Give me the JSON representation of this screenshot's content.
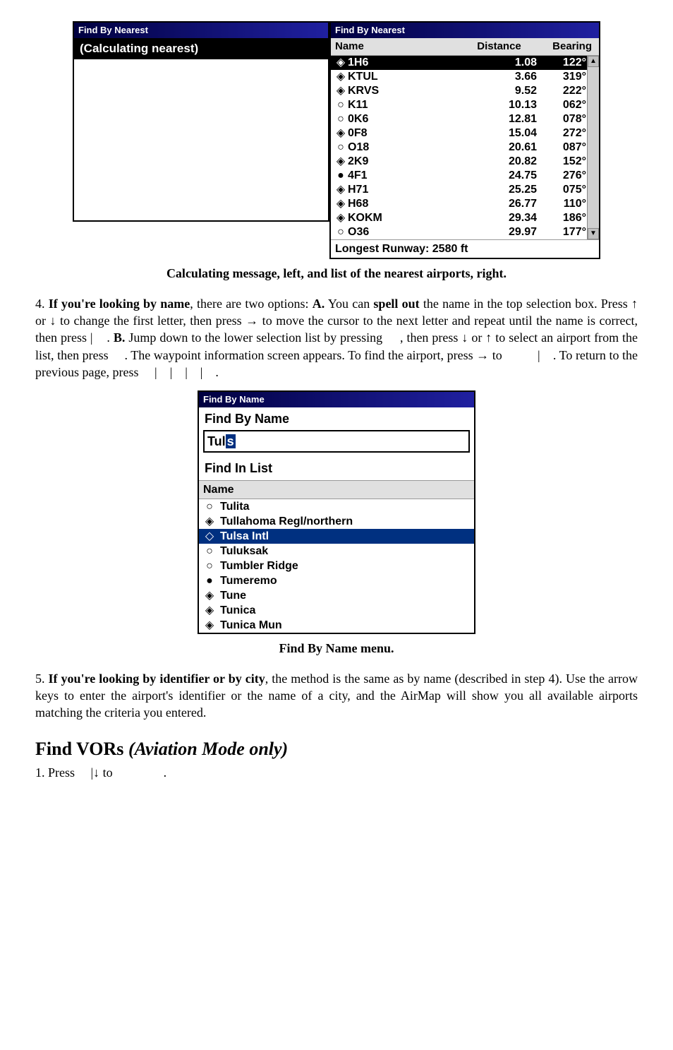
{
  "fig1": {
    "left_title": "Find By Nearest",
    "left_message": "(Calculating nearest)",
    "right_title": "Find By Nearest",
    "header": {
      "name": "Name",
      "distance": "Distance",
      "bearing": "Bearing"
    },
    "rows": [
      {
        "icon": "◈",
        "name": "1H6",
        "distance": "1.08",
        "bearing": "122°",
        "selected": true
      },
      {
        "icon": "◈",
        "name": "KTUL",
        "distance": "3.66",
        "bearing": "319°"
      },
      {
        "icon": "◈",
        "name": "KRVS",
        "distance": "9.52",
        "bearing": "222°"
      },
      {
        "icon": "○",
        "name": "K11",
        "distance": "10.13",
        "bearing": "062°"
      },
      {
        "icon": "○",
        "name": "0K6",
        "distance": "12.81",
        "bearing": "078°"
      },
      {
        "icon": "◈",
        "name": "0F8",
        "distance": "15.04",
        "bearing": "272°"
      },
      {
        "icon": "○",
        "name": "O18",
        "distance": "20.61",
        "bearing": "087°"
      },
      {
        "icon": "◈",
        "name": "2K9",
        "distance": "20.82",
        "bearing": "152°"
      },
      {
        "icon": "●",
        "name": "4F1",
        "distance": "24.75",
        "bearing": "276°"
      },
      {
        "icon": "◈",
        "name": "H71",
        "distance": "25.25",
        "bearing": "075°"
      },
      {
        "icon": "◈",
        "name": "H68",
        "distance": "26.77",
        "bearing": "110°"
      },
      {
        "icon": "◈",
        "name": "KOKM",
        "distance": "29.34",
        "bearing": "186°"
      },
      {
        "icon": "○",
        "name": "O36",
        "distance": "29.97",
        "bearing": "177°"
      }
    ],
    "footer": "Longest Runway: 2580 ft"
  },
  "caption1": "Calculating message, left, and list of the nearest airports, right.",
  "para4_parts": {
    "p1": "4. ",
    "bold1": "If you're looking by name",
    "p2": ", there are two options: ",
    "boldA": "A.",
    "p3": " You can ",
    "bold2": "spell out",
    "p4": " the name in the top selection box. Press ↑ or ↓ to change the first letter, then press → to move the cursor to the next letter and repeat until the name is correct, then press ",
    "key1": "|",
    "p5": ". ",
    "boldB": "B.",
    "p6": " Jump down to the lower selection list by pressing ",
    "p7": ", then press ↓ or ↑ to select an airport from the list, then press ",
    "p8": ". The waypoint information screen appears. To find the airport, press → to ",
    "key2": "|",
    "p9": ". To return to the previous page, press ",
    "key3": "|",
    "key4": "|",
    "key5": "|",
    "key6": "|",
    "p10": "."
  },
  "fig2": {
    "title": "Find By Name",
    "label1": "Find By Name",
    "input_prefix": "Tul",
    "input_cursor": "s",
    "label2": "Find In List",
    "header": "Name",
    "rows": [
      {
        "icon": "○",
        "name": "Tulita"
      },
      {
        "icon": "◈",
        "name": "Tullahoma Regl/northern"
      },
      {
        "icon": "◇",
        "name": "Tulsa Intl",
        "selected": true
      },
      {
        "icon": "○",
        "name": "Tuluksak"
      },
      {
        "icon": "○",
        "name": "Tumbler Ridge"
      },
      {
        "icon": "●",
        "name": "Tumeremo"
      },
      {
        "icon": "◈",
        "name": "Tune"
      },
      {
        "icon": "◈",
        "name": "Tunica"
      },
      {
        "icon": "◈",
        "name": "Tunica Mun"
      }
    ]
  },
  "caption2": "Find By Name menu.",
  "para5_parts": {
    "p1": "5. ",
    "bold1": "If you're looking by identifier or by city",
    "p2": ", the method is the same as by name (described in step 4). Use the arrow keys to enter the airport's identifier or the name of a city, and the AirMap will show you all available airports matching the criteria you entered."
  },
  "section_heading": {
    "main": "Find VORs ",
    "ital": "(Aviation Mode only)"
  },
  "step1": {
    "p1": "1. Press ",
    "key1": "|↓ to",
    "p2": "."
  }
}
